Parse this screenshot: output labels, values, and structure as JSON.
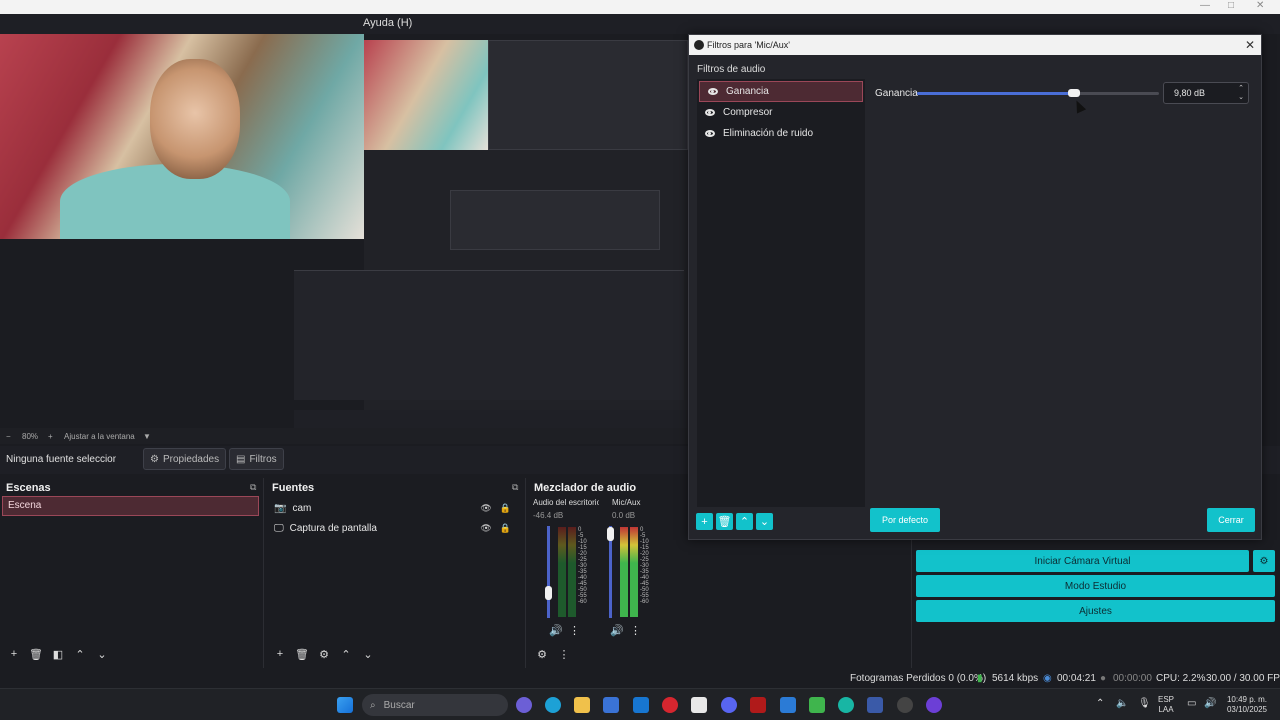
{
  "menubar": {
    "help": "Ayuda (H)"
  },
  "preview": {
    "zoom": "80%",
    "fit_label": "Ajustar a la ventana"
  },
  "source_toolbar": {
    "no_source": "Ninguna fuente seleccionada",
    "properties": "Propiedades",
    "filters": "Filtros"
  },
  "scenes": {
    "title": "Escenas",
    "items": [
      "Escena"
    ]
  },
  "sources": {
    "title": "Fuentes",
    "items": [
      {
        "label": "cam",
        "icon": "camera-icon"
      },
      {
        "label": "Captura de pantalla",
        "icon": "monitor-icon"
      }
    ]
  },
  "mixer": {
    "title": "Mezclador de audio",
    "channels": [
      {
        "name": "Audio del escritorio",
        "db": "-46.4 dB"
      },
      {
        "name": "Mic/Aux",
        "db": "0.0 dB"
      }
    ],
    "ticks": [
      "0",
      "-5",
      "-10",
      "-15",
      "-20",
      "-25",
      "-30",
      "-35",
      "-40",
      "-45",
      "-50",
      "-55",
      "-60"
    ]
  },
  "controls": {
    "virtual_cam": "Iniciar Cámara Virtual",
    "studio_mode": "Modo Estudio",
    "settings": "Ajustes"
  },
  "status": {
    "dropped": "Fotogramas Perdidos 0 (0.0%)",
    "bitrate": "5614 kbps",
    "stream_time": "00:04:21",
    "rec_time": "00:00:00",
    "cpu": "CPU: 2.2%",
    "fps": "30.00 / 30.00 FPS"
  },
  "taskbar": {
    "search_placeholder": "Buscar",
    "lang_top": "ESP",
    "lang_bottom": "LAA",
    "time": "10:49 p. m.",
    "date": "03/10/2025"
  },
  "dialog": {
    "title": "Filtros para 'Mic/Aux'",
    "section": "Filtros de audio",
    "filters": [
      "Ganancia",
      "Compresor",
      "Eliminación de ruido"
    ],
    "selected_index": 0,
    "gain_label": "Ganancia",
    "gain_value": "9,80 dB",
    "gain_fraction": 0.65,
    "defaults": "Por defecto",
    "close": "Cerrar"
  },
  "colors": {
    "accent": "#12c2cb",
    "selection": "#4d2a33",
    "slider": "#4a6ed6"
  }
}
